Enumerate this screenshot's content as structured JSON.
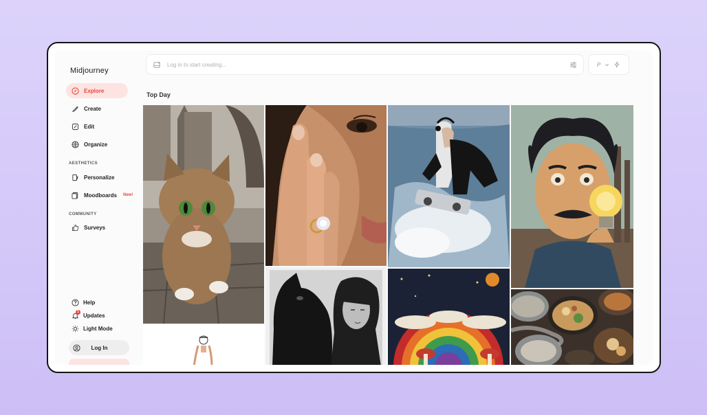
{
  "app": {
    "name": "Midjourney"
  },
  "nav": {
    "explore": "Explore",
    "create": "Create",
    "edit": "Edit",
    "organize": "Organize",
    "aesthetics_label": "AESTHETICS",
    "personalize": "Personalize",
    "moodboards": "Moodboards",
    "moodboards_badge": "New!",
    "community_label": "COMMUNITY",
    "surveys": "Surveys"
  },
  "footer": {
    "help": "Help",
    "updates": "Updates",
    "updates_count": "1",
    "light_mode": "Light Mode",
    "login": "Log In"
  },
  "search": {
    "placeholder": "Log in to start creating..."
  },
  "profile": {
    "initial": "P"
  },
  "section": {
    "title": "Top Day"
  },
  "gallery": [
    {
      "name": "kitten-cathedral",
      "desc": "kitten"
    },
    {
      "name": "hand-ring-portrait",
      "desc": "ring"
    },
    {
      "name": "dj-on-ice",
      "desc": "dj"
    },
    {
      "name": "inventor-lightbulb",
      "desc": "lightbulb"
    },
    {
      "name": "woman-with-dog",
      "desc": "dog"
    },
    {
      "name": "felt-rainbow",
      "desc": "rainbow"
    },
    {
      "name": "food-bowls",
      "desc": "food"
    },
    {
      "name": "sketch-figure",
      "desc": "sketch"
    }
  ],
  "colors": {
    "accent": "#e5473a",
    "active_bg": "#fde4e2",
    "background": "#d6cbf9"
  }
}
